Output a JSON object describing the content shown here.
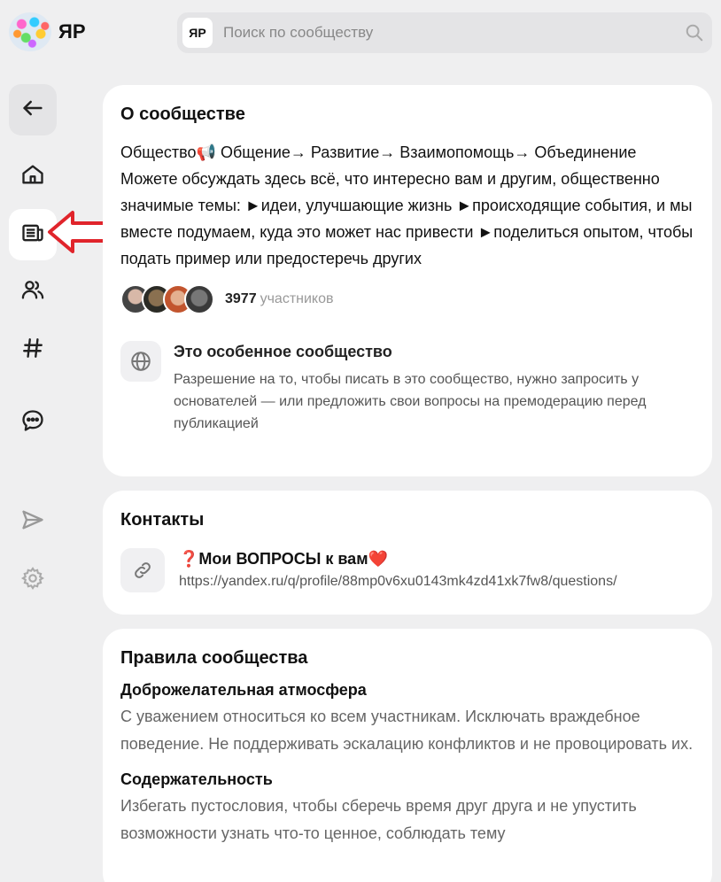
{
  "header": {
    "logo_text": "ЯР",
    "search_badge": "ЯР",
    "search_placeholder": "Поиск по сообществу"
  },
  "sidebar": {
    "items": [
      {
        "name": "back",
        "icon": "arrow-left-icon"
      },
      {
        "name": "home",
        "icon": "home-icon"
      },
      {
        "name": "about",
        "icon": "newspaper-icon",
        "active": true
      },
      {
        "name": "members",
        "icon": "people-icon"
      },
      {
        "name": "tags",
        "icon": "hash-icon"
      },
      {
        "name": "chats",
        "icon": "chat-icon"
      },
      {
        "name": "share",
        "icon": "send-icon"
      },
      {
        "name": "settings",
        "icon": "gear-icon"
      }
    ]
  },
  "about": {
    "title": "О сообществе",
    "description": "Общество📢 Общение→ Развитие→ Взаимопомощь→ Объединение\nМожете обсуждать здесь всё, что интересно вам и другим, общественно значимые темы: ►идеи, улучшающие жизнь ►происходящие события, и мы вместе подумаем, куда это может нас привести ►поделиться опытом, чтобы подать пример или предостеречь других",
    "members_count": "3977",
    "members_label": "участников",
    "special_title": "Это особенное сообщество",
    "special_text": "Разрешение на то, чтобы писать в это сообщество, нужно запросить у основателей — или предложить свои вопросы на премодерацию перед публикацией"
  },
  "contacts": {
    "title": "Контакты",
    "items": [
      {
        "title": "❓Мои ВОПРОСЫ к вам❤️",
        "url": "https://yandex.ru/q/profile/88mp0v6xu0143mk4zd41xk7fw8/questions/"
      }
    ]
  },
  "rules": {
    "title": "Правила сообщества",
    "items": [
      {
        "title": "Доброжелательная атмосфера",
        "text": "С уважением относиться ко всем участникам. Исключать враждебное поведение. Не поддерживать эскалацию конфликтов и не провоцировать их."
      },
      {
        "title": "Содержательность",
        "text": "Избегать пустословия, чтобы сберечь время друг друга и не упустить возможности узнать что-то ценное, соблюдать тему"
      }
    ]
  },
  "colors": {
    "background": "#efeff0",
    "card": "#ffffff",
    "annotation_arrow": "#e0242b"
  }
}
